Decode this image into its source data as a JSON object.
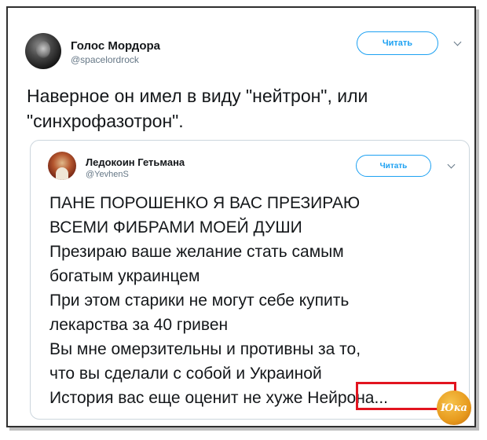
{
  "tweet": {
    "author_name": "Голос Мордора",
    "author_handle": "@spacelordrock",
    "follow_label": "Читать",
    "text": "Наверное он имел в виду \"нейтрон\", или \"синхрофазотрон\"."
  },
  "quoted": {
    "author_name": "Ледокоин Гетьмана",
    "author_handle": "@YevhenS",
    "follow_label": "Читать",
    "lines": [
      "ПАНЕ ПОРОШЕНКО Я ВАС ПРЕЗИРАЮ",
      "ВСЕМИ ФИБРАМИ МОЕЙ ДУШИ",
      "Презираю ваше желание стать самым",
      "богатым украинцем",
      "При этом старики не могут себе купить",
      "лекарства за 40 гривен",
      "Вы мне омерзительны и противны за то,",
      "что вы сделали с собой и Украиной",
      "История вас еще оценит не хуже Нейрона..."
    ]
  },
  "watermark": {
    "text": "Юка"
  },
  "colors": {
    "accent": "#1da1f2",
    "highlight": "#e2141f"
  }
}
